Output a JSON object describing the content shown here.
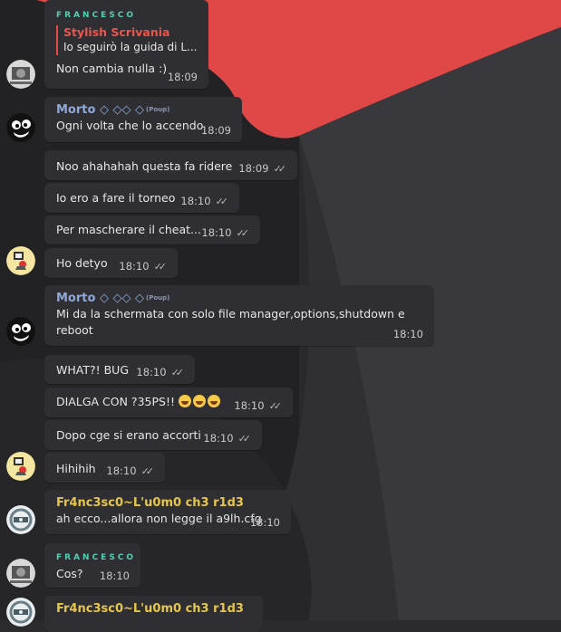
{
  "messages": [
    {
      "id": "m1",
      "sender": "FRANCESCO",
      "reply_name": "Stylish Scrivania",
      "reply_text": "Io seguirò la guida di L...",
      "text": "Non cambia nulla :)",
      "time": "18:09"
    },
    {
      "id": "m2",
      "sender": "Morto ◇ ◇◇ ◇",
      "badge": "(Poup)",
      "text": "Ogni volta che lo accendo",
      "time": "18:09"
    },
    {
      "id": "m3",
      "text": "Noo ahahahah questa fa ridere",
      "time": "18:09",
      "ticks": "✓✓"
    },
    {
      "id": "m4",
      "text": "Io ero a fare il torneo",
      "time": "18:10",
      "ticks": "✓✓"
    },
    {
      "id": "m5",
      "text": "Per mascherare il cheat...",
      "time": "18:10",
      "ticks": "✓✓"
    },
    {
      "id": "m6",
      "text": "Ho detyo",
      "time": "18:10",
      "ticks": "✓✓"
    },
    {
      "id": "m7",
      "sender": "Morto ◇ ◇◇ ◇",
      "badge": "(Poup)",
      "text_line1": "Mi da la schermata con solo file manager,options,shutdown e",
      "text_line2": "reboot",
      "time": "18:10"
    },
    {
      "id": "m8",
      "text": "WHAT?! BUG",
      "time": "18:10",
      "ticks": "✓✓"
    },
    {
      "id": "m9",
      "text": "DIALGA CON ?35PS!!",
      "time": "18:10",
      "ticks": "✓✓"
    },
    {
      "id": "m10",
      "text": "Dopo cge si erano accorti",
      "time": "18:10",
      "ticks": "✓✓"
    },
    {
      "id": "m11",
      "text": "Hihihih",
      "time": "18:10",
      "ticks": "✓✓"
    },
    {
      "id": "m12",
      "sender": "Fr4nc3sc0~L'u0m0 ch3 r1d3",
      "text": "ah ecco...allora non legge il a9lh.cfg",
      "time": "18:10"
    },
    {
      "id": "m13",
      "sender": "FRANCESCO",
      "text": "Cos?",
      "time": "18:10"
    },
    {
      "id": "m14",
      "sender": "Fr4nc3sc0~L'u0m0 ch3 r1d3"
    }
  ],
  "colors": {
    "francesco": "#4fd1b2",
    "morto": "#8fa8d8",
    "fr4nc": "#e6c64a",
    "reply": "#e8574e",
    "bubble": "#2f2f33"
  }
}
